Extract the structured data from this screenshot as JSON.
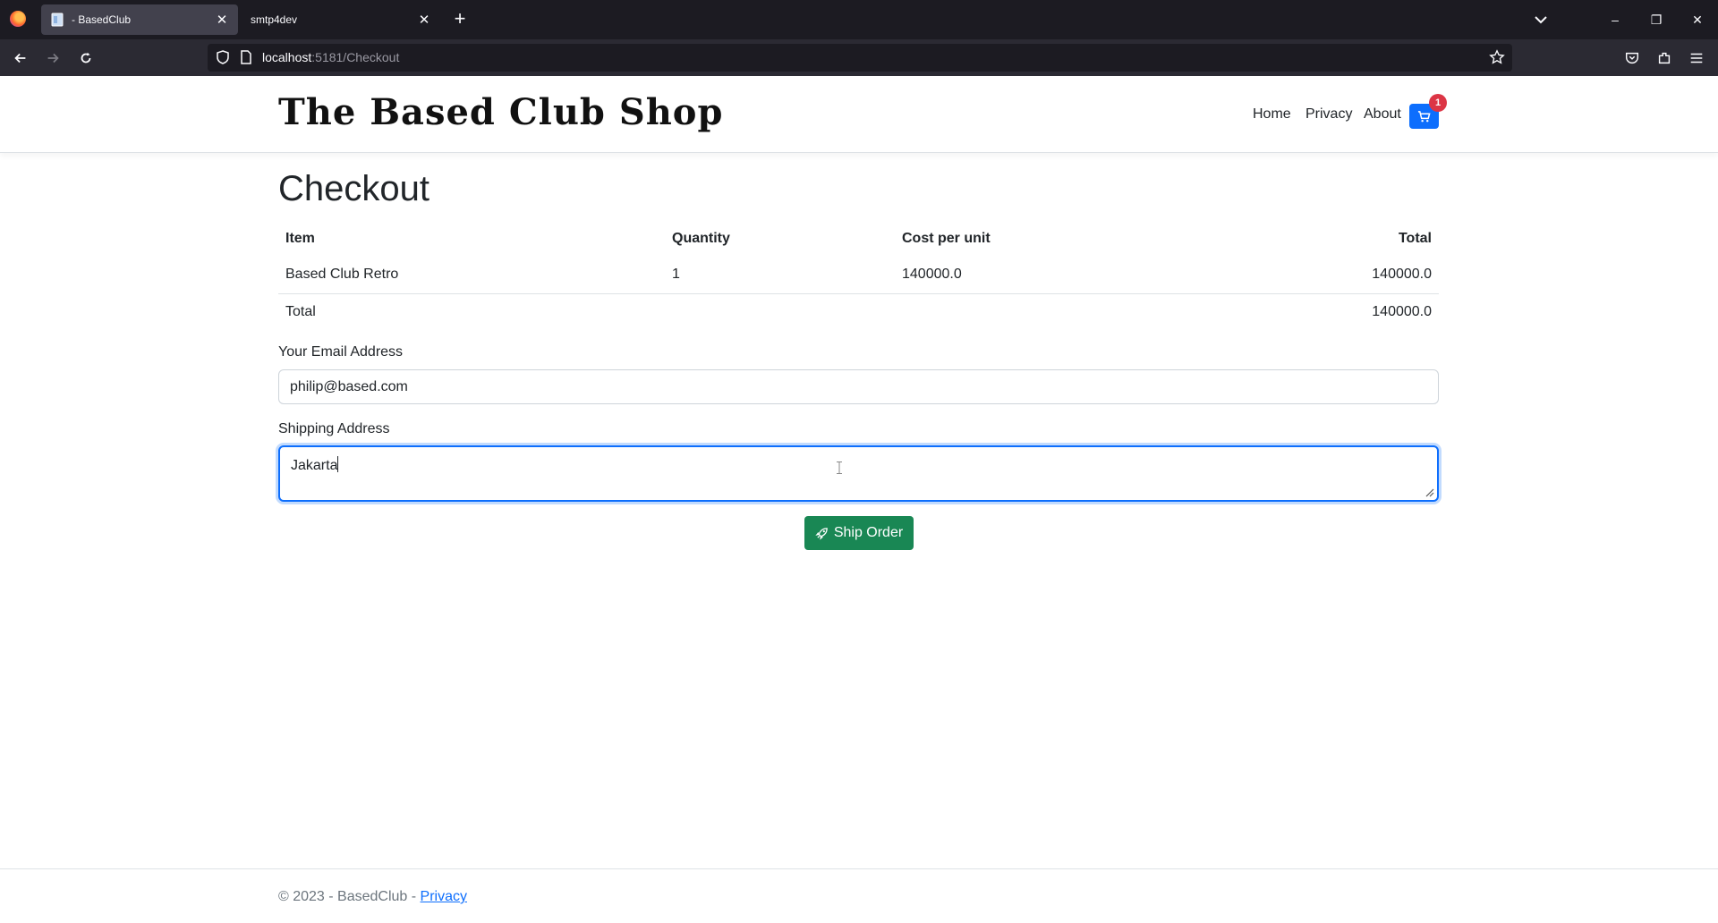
{
  "browser": {
    "tabs": [
      {
        "title": "- BasedClub",
        "active": true
      },
      {
        "title": "smtp4dev",
        "active": false
      }
    ],
    "new_tab_symbol": "+",
    "close_symbol": "✕",
    "url_host": "localhost",
    "url_rest": ":5181/Checkout",
    "window_controls": {
      "minimize": "–",
      "restore": "❐",
      "close": "✕"
    }
  },
  "header": {
    "brand": "The Based Club Shop",
    "nav": [
      "Home",
      "Privacy",
      "About"
    ],
    "cart_count": "1",
    "accent_color": "#0d6efd",
    "badge_color": "#dc3545"
  },
  "checkout": {
    "title": "Checkout",
    "columns": [
      "Item",
      "Quantity",
      "Cost per unit",
      "Total"
    ],
    "rows": [
      {
        "item": "Based Club Retro",
        "quantity": "1",
        "cost": "140000.0",
        "total": "140000.0"
      }
    ],
    "total_label": "Total",
    "grand_total": "140000.0",
    "email_label": "Your Email Address",
    "email_value": "philip@based.com",
    "address_label": "Shipping Address",
    "address_value": "Jakarta",
    "submit_label": "Ship Order",
    "submit_color": "#198754"
  },
  "footer": {
    "copyright": "© 2023 - BasedClub - ",
    "privacy_link": "Privacy"
  }
}
